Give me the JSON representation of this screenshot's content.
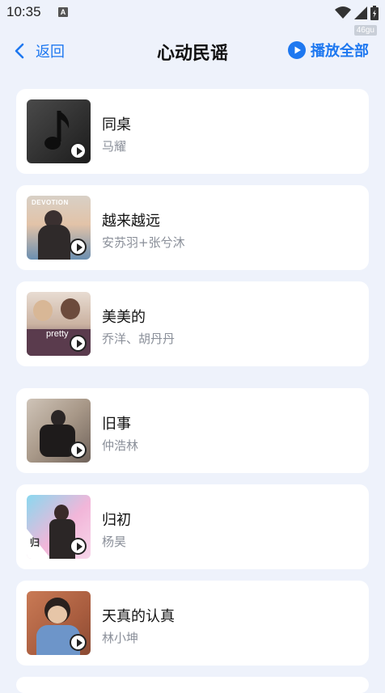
{
  "status": {
    "time": "10:35",
    "app_indicator": "A",
    "speed": "46gu"
  },
  "header": {
    "back_label": "返回",
    "title": "心动民谣",
    "play_all_label": "播放全部"
  },
  "colors": {
    "accent": "#1e78f0",
    "background": "#eef2fb"
  },
  "songs": [
    {
      "title": "同桌",
      "artist": "马耀"
    },
    {
      "title": "越来越远",
      "artist": "安苏羽+张兮沐",
      "cover_text": "DEVOTION"
    },
    {
      "title": "美美的",
      "artist": "乔洋、胡丹丹",
      "cover_text": "pretty"
    },
    {
      "title": "旧事",
      "artist": "仲浩林"
    },
    {
      "title": "归初",
      "artist": "杨昊",
      "cover_text": "归"
    },
    {
      "title": "天真的认真",
      "artist": "林小坤"
    }
  ]
}
